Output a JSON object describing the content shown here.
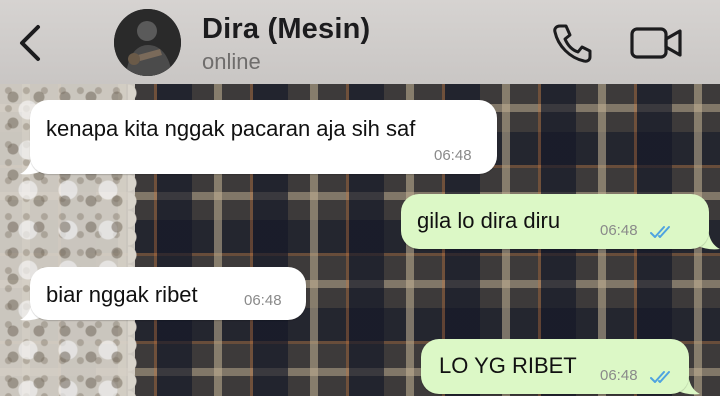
{
  "header": {
    "contact_name": "Dira (Mesin)",
    "contact_status": "online",
    "icons": {
      "back": "chevron-left-icon",
      "call": "phone-icon",
      "video": "video-camera-icon"
    }
  },
  "colors": {
    "header_bg": "#d0cdcb",
    "incoming_bubble": "#ffffff",
    "outgoing_bubble": "#dcf8c6",
    "read_tick": "#4fa3e0",
    "timestamp": "#8a8a8a"
  },
  "messages": [
    {
      "direction": "incoming",
      "text": "kenapa kita nggak pacaran aja sih saf",
      "time": "06:48"
    },
    {
      "direction": "outgoing",
      "text": "gila lo dira diru",
      "time": "06:48",
      "status": "read"
    },
    {
      "direction": "incoming",
      "text": "biar nggak ribet",
      "time": "06:48"
    },
    {
      "direction": "outgoing",
      "text": "LO YG RIBET",
      "time": "06:48",
      "status": "read"
    }
  ]
}
